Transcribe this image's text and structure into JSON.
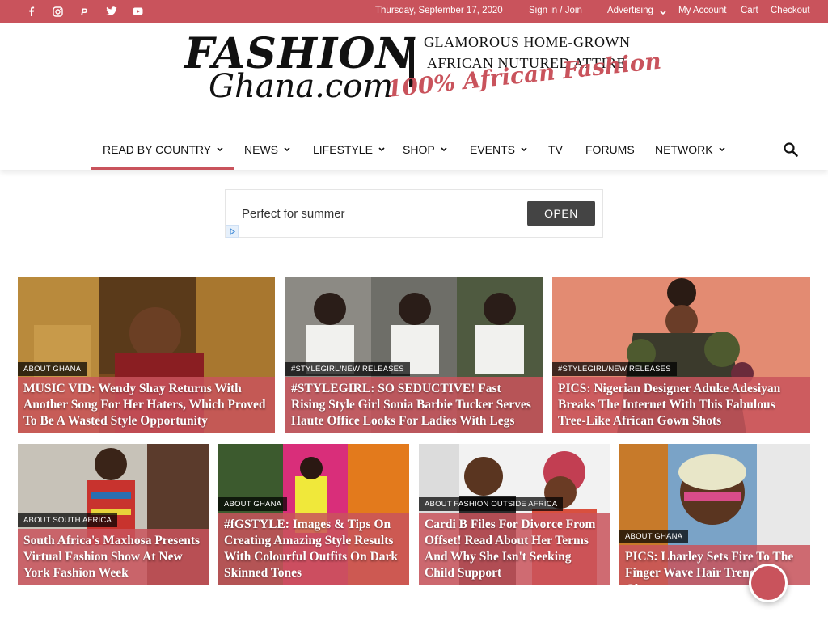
{
  "topbar": {
    "date": "Thursday, September 17, 2020",
    "signin": "Sign in / Join",
    "advertising": "Advertising",
    "account": "My Account",
    "cart": "Cart",
    "checkout": "Checkout",
    "social_icons": [
      "facebook-icon",
      "instagram-icon",
      "patreon-icon",
      "twitter-icon",
      "youtube-icon"
    ],
    "color": "#c9535c"
  },
  "logo": {
    "line1": "FASHION",
    "line2": "Ghana.com",
    "tagline1": "GLAMOROUS HOME-GROWN",
    "tagline2": "AFRICAN NUTURED ATTIRE",
    "tagline3": "100% African Fashion"
  },
  "nav": {
    "items": [
      {
        "label": "READ BY COUNTRY",
        "dropdown": true,
        "active": true
      },
      {
        "label": "NEWS",
        "dropdown": true
      },
      {
        "label": "LIFESTYLE",
        "dropdown": true
      },
      {
        "label": "SHOP",
        "dropdown": true
      },
      {
        "label": "EVENTS",
        "dropdown": true
      },
      {
        "label": "TV",
        "dropdown": false
      },
      {
        "label": "FORUMS",
        "dropdown": false
      },
      {
        "label": "NETWORK",
        "dropdown": true
      }
    ]
  },
  "ad": {
    "text": "Perfect for summer",
    "button": "OPEN"
  },
  "tiles_row1": [
    {
      "category": "ABOUT GHANA",
      "title": "MUSIC VID: Wendy Shay Returns With Another Song For Her Haters, Which Proved To Be A Wasted Style Opportunity"
    },
    {
      "category": "#STYLEGIRL/NEW RELEASES",
      "title": "#STYLEGIRL: SO SEDUCTIVE! Fast Rising Style Girl Sonia Barbie Tucker Serves Haute Office Looks For Ladies With Legs"
    },
    {
      "category": "#STYLEGIRL/NEW RELEASES",
      "title": "PICS: Nigerian Designer Aduke Adesiyan Breaks The Internet With This Fabulous Tree-Like African Gown Shots"
    }
  ],
  "tiles_row2": [
    {
      "category": "ABOUT SOUTH AFRICA",
      "title": "South Africa's Maxhosa Presents Virtual Fashion Show At New York Fashion Week"
    },
    {
      "category": "ABOUT GHANA",
      "title": "#fGSTYLE: Images & Tips On Creating Amazing Style Results With Colourful Outfits On Dark Skinned Tones"
    },
    {
      "category": "ABOUT FASHION OUTSIDE AFRICA",
      "title": "Cardi B Files For Divorce From Offset! Read About Her Terms And Why She Isn't Seeking Child Support"
    },
    {
      "category": "ABOUT GHANA",
      "title": "PICS: Lharley Sets Fire To The Finger Wave Hair Trend In Ghana"
    }
  ]
}
